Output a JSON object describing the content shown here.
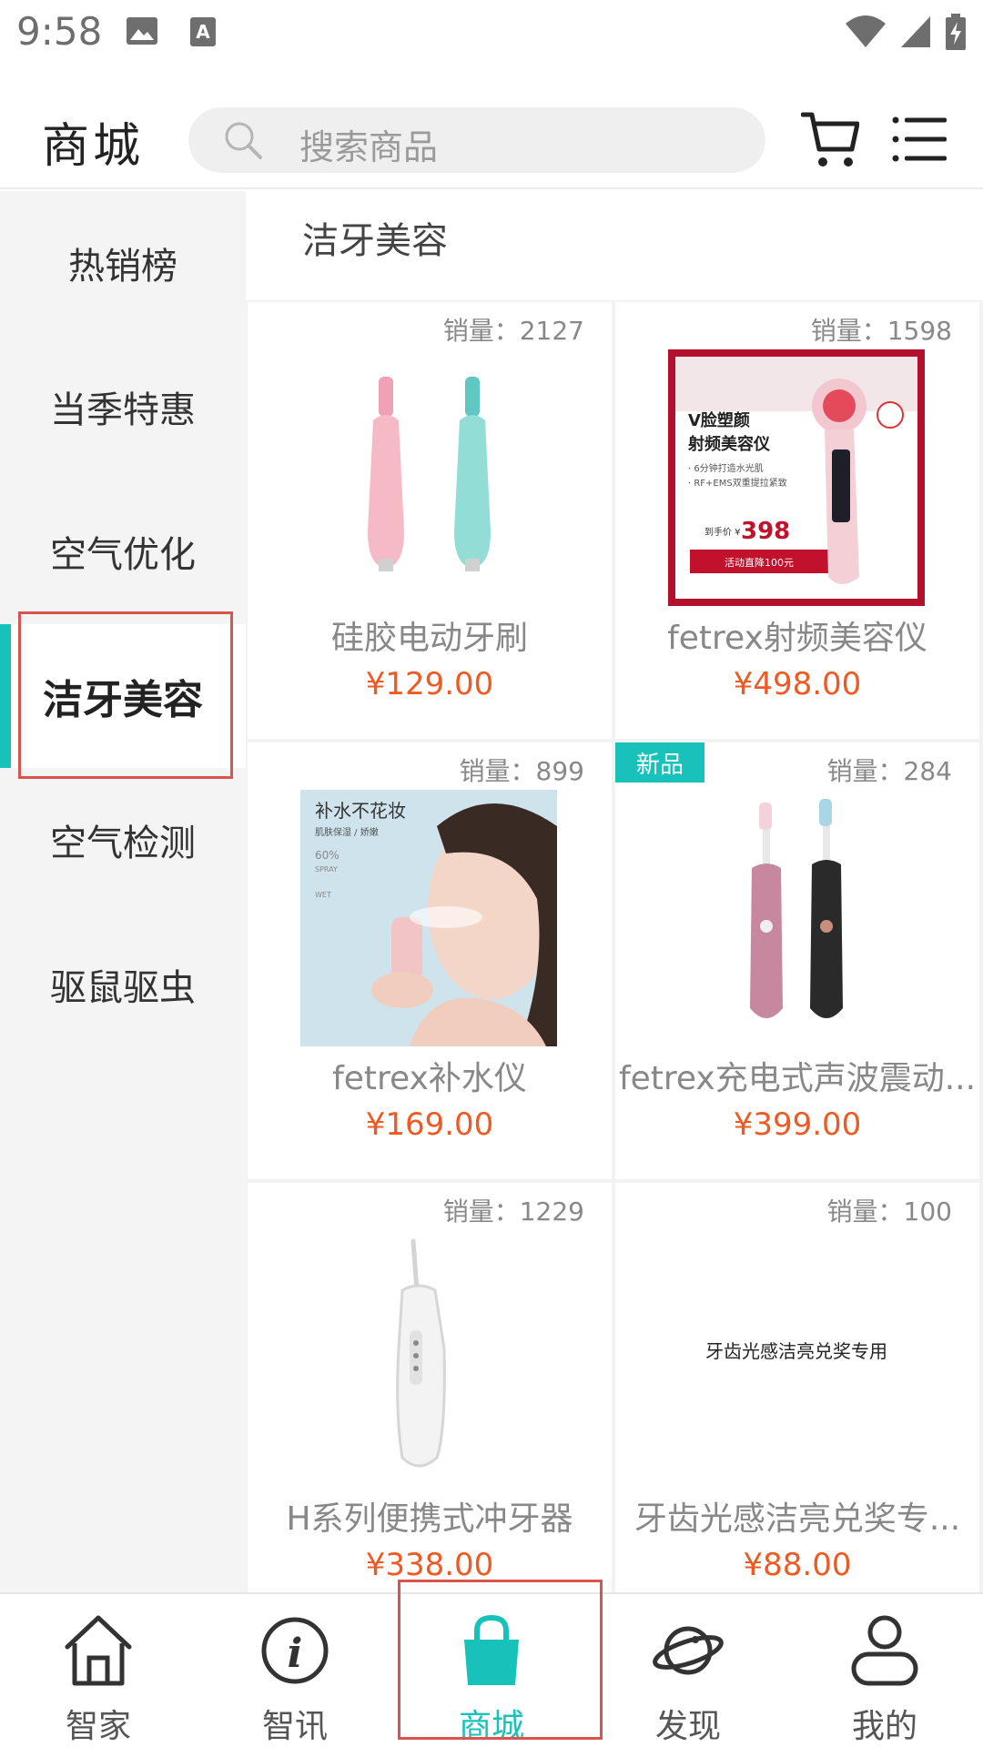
{
  "status_bar": {
    "time": "9:58",
    "left_icons": [
      "image-icon",
      "text-a-icon"
    ],
    "right_icons": [
      "wifi-icon",
      "signal-icon",
      "battery-charging-icon"
    ]
  },
  "header": {
    "title": "商城",
    "search_placeholder": "搜索商品",
    "icons": [
      "search-icon",
      "cart-icon",
      "menu-icon"
    ]
  },
  "sidebar": {
    "items": [
      {
        "label": "热销榜",
        "active": false
      },
      {
        "label": "当季特惠",
        "active": false
      },
      {
        "label": "空气优化",
        "active": false
      },
      {
        "label": "洁牙美容",
        "active": true
      },
      {
        "label": "空气检测",
        "active": false
      },
      {
        "label": "驱鼠驱虫",
        "active": false
      }
    ]
  },
  "main": {
    "section_title": "洁牙美容",
    "products": [
      {
        "sales": "销量：2127",
        "name": "硅胶电动牙刷",
        "price": "¥129.00",
        "badge": ""
      },
      {
        "sales": "销量：1598",
        "name": "fetrex射频美容仪",
        "price": "¥498.00",
        "badge": "",
        "image_text": {
          "line1": "V脸塑颜",
          "line2": "射频美容仪",
          "line3": "· 6分钟打造水光肌",
          "line4": "· RF+EMS双重提拉紧致",
          "price_label": "到手价 ¥",
          "price_value": "398",
          "cta": "活动直降100元"
        }
      },
      {
        "sales": "销量：899",
        "name": "fetrex补水仪",
        "price": "¥169.00",
        "badge": "",
        "image_text": {
          "line1": "补水不花妆",
          "line2": "肌肤保湿 / 娇嫩",
          "line3": "60%",
          "line4": "SPRAY",
          "line5": "WET"
        }
      },
      {
        "sales": "销量：284",
        "name": "fetrex充电式声波震动...",
        "price": "¥399.00",
        "badge": "新品"
      },
      {
        "sales": "销量：1229",
        "name": "H系列便携式冲牙器",
        "price": "¥338.00",
        "badge": ""
      },
      {
        "sales": "销量：100",
        "name": "牙齿光感洁亮兑奖专...",
        "price": "¥88.00",
        "badge": "",
        "image_text": {
          "line1": "牙齿光感洁亮兑奖专用"
        }
      }
    ]
  },
  "bottom_nav": {
    "items": [
      {
        "label": "智家",
        "icon": "home-icon",
        "active": false
      },
      {
        "label": "智讯",
        "icon": "info-icon",
        "active": false
      },
      {
        "label": "商城",
        "icon": "shopping-bag-icon",
        "active": true
      },
      {
        "label": "发现",
        "icon": "planet-icon",
        "active": false
      },
      {
        "label": "我的",
        "icon": "user-icon",
        "active": false
      }
    ]
  },
  "colors": {
    "accent": "#18c2bb",
    "price": "#ee5a24",
    "highlight_frame": "#d9534f"
  }
}
